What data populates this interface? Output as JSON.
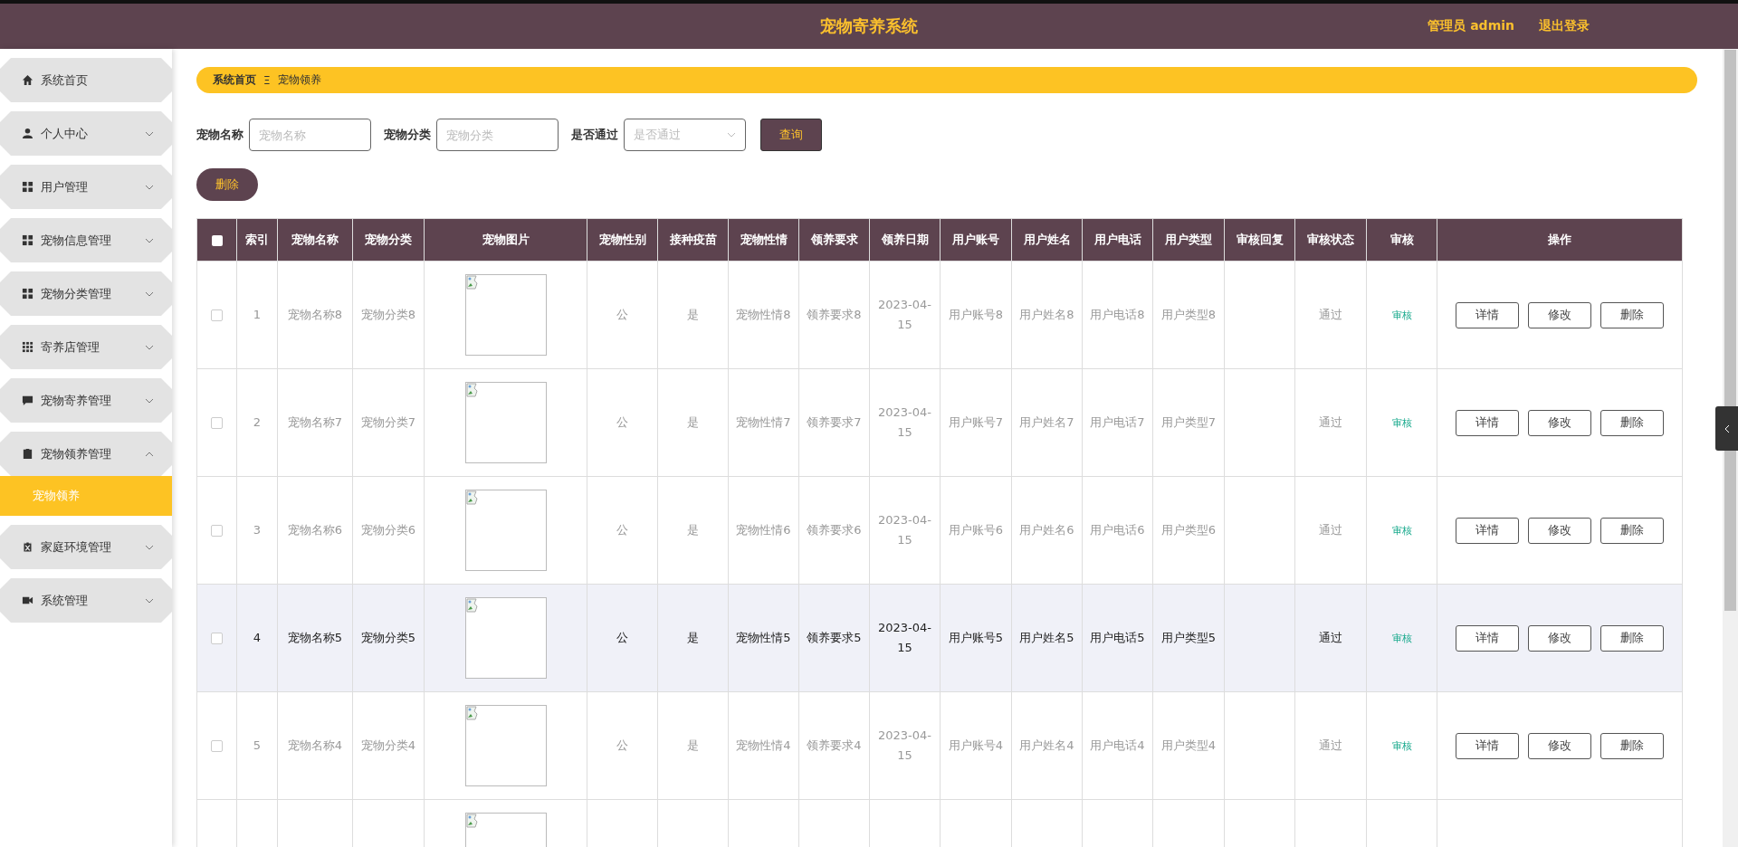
{
  "header": {
    "title": "宠物寄养系统",
    "user": "管理员 admin",
    "logout": "退出登录"
  },
  "sidebar": {
    "items": [
      {
        "label": "系统首页"
      },
      {
        "label": "个人中心",
        "expanded": false
      },
      {
        "label": "用户管理",
        "expanded": false
      },
      {
        "label": "宠物信息管理",
        "expanded": false
      },
      {
        "label": "宠物分类管理",
        "expanded": false
      },
      {
        "label": "寄养店管理",
        "expanded": false
      },
      {
        "label": "宠物寄养管理",
        "expanded": false
      },
      {
        "label": "宠物领养管理",
        "expanded": true,
        "children": [
          {
            "label": "宠物领养",
            "selected": true
          }
        ]
      },
      {
        "label": "家庭环境管理",
        "expanded": false
      },
      {
        "label": "系统管理",
        "expanded": false
      }
    ]
  },
  "breadcrumb": {
    "items": [
      "系统首页",
      "宠物领养"
    ],
    "separator": "Ξ"
  },
  "search": {
    "fields": [
      {
        "label": "宠物名称",
        "placeholder": "宠物名称",
        "kind": "input"
      },
      {
        "label": "宠物分类",
        "placeholder": "宠物分类",
        "kind": "input"
      },
      {
        "label": "是否通过",
        "placeholder": "是否通过",
        "kind": "select"
      }
    ],
    "button": "查询"
  },
  "delete_button": "删除",
  "table": {
    "select_all": {
      "checked": false
    },
    "columns": [
      "索引",
      "宠物名称",
      "宠物分类",
      "宠物图片",
      "宠物性别",
      "接种疫苗",
      "宠物性情",
      "领养要求",
      "领养日期",
      "用户账号",
      "用户姓名",
      "用户电话",
      "用户类型",
      "审核回复",
      "审核状态",
      "审核",
      "操作"
    ],
    "rows": [
      {
        "checked": false,
        "hovered": false,
        "index": "1",
        "name": "宠物名称8",
        "category": "宠物分类8",
        "sex": "公",
        "vaccine": "是",
        "temperament": "宠物性情8",
        "requirement": "领养要求8",
        "date": "2023-04-15",
        "account": "用户账号8",
        "user_name": "用户姓名8",
        "phone": "用户电话8",
        "user_type": "用户类型8",
        "status": "通过",
        "audit": "审核",
        "actions": [
          "详情",
          "修改",
          "删除"
        ]
      },
      {
        "checked": false,
        "hovered": false,
        "index": "2",
        "name": "宠物名称7",
        "category": "宠物分类7",
        "sex": "公",
        "vaccine": "是",
        "temperament": "宠物性情7",
        "requirement": "领养要求7",
        "date": "2023-04-15",
        "account": "用户账号7",
        "user_name": "用户姓名7",
        "phone": "用户电话7",
        "user_type": "用户类型7",
        "status": "通过",
        "audit": "审核",
        "actions": [
          "详情",
          "修改",
          "删除"
        ]
      },
      {
        "checked": false,
        "hovered": false,
        "index": "3",
        "name": "宠物名称6",
        "category": "宠物分类6",
        "sex": "公",
        "vaccine": "是",
        "temperament": "宠物性情6",
        "requirement": "领养要求6",
        "date": "2023-04-15",
        "account": "用户账号6",
        "user_name": "用户姓名6",
        "phone": "用户电话6",
        "user_type": "用户类型6",
        "status": "通过",
        "audit": "审核",
        "actions": [
          "详情",
          "修改",
          "删除"
        ]
      },
      {
        "checked": false,
        "hovered": true,
        "index": "4",
        "name": "宠物名称5",
        "category": "宠物分类5",
        "sex": "公",
        "vaccine": "是",
        "temperament": "宠物性情5",
        "requirement": "领养要求5",
        "date": "2023-04-15",
        "account": "用户账号5",
        "user_name": "用户姓名5",
        "phone": "用户电话5",
        "user_type": "用户类型5",
        "status": "通过",
        "audit": "审核",
        "actions": [
          "详情",
          "修改",
          "删除"
        ]
      },
      {
        "checked": false,
        "hovered": false,
        "index": "5",
        "name": "宠物名称4",
        "category": "宠物分类4",
        "sex": "公",
        "vaccine": "是",
        "temperament": "宠物性情4",
        "requirement": "领养要求4",
        "date": "2023-04-15",
        "account": "用户账号4",
        "user_name": "用户姓名4",
        "phone": "用户电话4",
        "user_type": "用户类型4",
        "status": "通过",
        "audit": "审核",
        "actions": [
          "详情",
          "修改",
          "删除"
        ]
      },
      {
        "hovered": false
      }
    ]
  }
}
